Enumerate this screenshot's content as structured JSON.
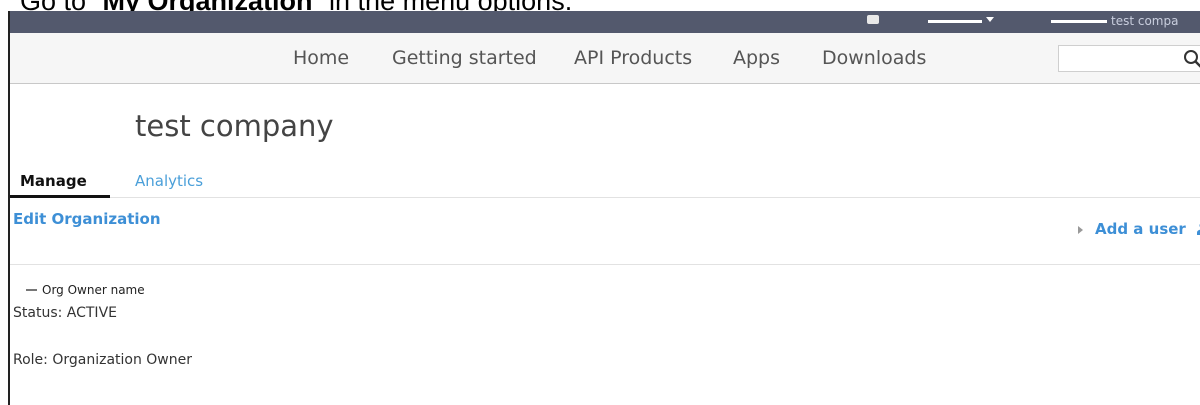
{
  "instruction": {
    "prefix": "Go to “",
    "bold": "My Organization",
    "suffix": "” in the menu options."
  },
  "topbar": {
    "user_label": "test compa"
  },
  "nav": {
    "items": [
      {
        "label": "Home"
      },
      {
        "label": "Getting started"
      },
      {
        "label": "API Products"
      },
      {
        "label": "Apps"
      },
      {
        "label": "Downloads"
      }
    ],
    "search_placeholder": ""
  },
  "page": {
    "title": "test company"
  },
  "tabs": [
    {
      "label": "Manage",
      "active": true
    },
    {
      "label": "Analytics",
      "active": false
    }
  ],
  "actions": {
    "edit_org": "Edit Organization",
    "add_user": "Add a user"
  },
  "member": {
    "name": "Org Owner name",
    "status": "Status: ACTIVE",
    "role": "Role: Organization Owner"
  },
  "colors": {
    "topbar": "#53596d",
    "link": "#3d8fd6",
    "tab_inactive": "#4a9fd9"
  },
  "icons": {
    "search": "search-icon",
    "add_user": "person-icon",
    "collapse": "minus-icon",
    "expand": "triangle-right-icon"
  }
}
